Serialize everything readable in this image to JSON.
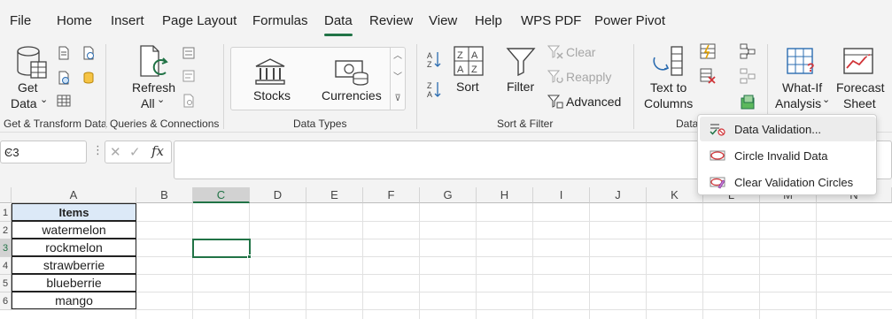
{
  "menu": {
    "tabs": [
      {
        "label": "File"
      },
      {
        "label": "Home"
      },
      {
        "label": "Insert"
      },
      {
        "label": "Page Layout"
      },
      {
        "label": "Formulas"
      },
      {
        "label": "Data"
      },
      {
        "label": "Review"
      },
      {
        "label": "View"
      },
      {
        "label": "Help"
      },
      {
        "label": "WPS PDF"
      },
      {
        "label": "Power Pivot"
      }
    ],
    "active_tab": "Data"
  },
  "ribbon": {
    "get_data": {
      "line1": "Get",
      "line2": "Data",
      "chevron": "⌄"
    },
    "refresh_all": {
      "line1": "Refresh",
      "line2": "All",
      "chevron": "⌄"
    },
    "stocks": "Stocks",
    "currencies": "Currencies",
    "sort": "Sort",
    "filter": "Filter",
    "clear": "Clear",
    "reapply": "Reapply",
    "advanced": "Advanced",
    "text_to_columns": {
      "line1": "Text to",
      "line2": "Columns"
    },
    "what_if": {
      "line1": "What-If",
      "line2": "Analysis",
      "chevron": "⌄"
    },
    "forecast": {
      "line1": "Forecast",
      "line2": "Sheet"
    },
    "groups": {
      "get_transform": "Get & Transform Data",
      "queries": "Queries & Connections",
      "data_types": "Data Types",
      "sort_filter": "Sort & Filter",
      "data_tools": "Data"
    }
  },
  "formula_bar": {
    "name_box": "C3",
    "fx": "fx",
    "value": ""
  },
  "grid": {
    "columns": [
      "A",
      "B",
      "C",
      "D",
      "E",
      "F",
      "G",
      "H",
      "I",
      "J",
      "K",
      "L",
      "M",
      "N"
    ],
    "rows": [
      "1",
      "2",
      "3",
      "4",
      "5",
      "6"
    ],
    "selected_cell": "C3",
    "table_header": "Items",
    "items": [
      "watermelon",
      "rockmelon",
      "strawberrie",
      "blueberrie",
      "mango"
    ]
  },
  "dropdown": {
    "items": [
      {
        "label": "Data Validation...",
        "icon": "data-validation-icon"
      },
      {
        "label": "Circle Invalid Data",
        "icon": "circle-invalid-icon"
      },
      {
        "label": "Clear Validation Circles",
        "icon": "clear-circles-icon"
      }
    ]
  },
  "colors": {
    "accent": "#217346",
    "header_fill": "#dce9f7",
    "ribbon_bg": "#f3f3f3",
    "clear_x": "#d13438"
  }
}
